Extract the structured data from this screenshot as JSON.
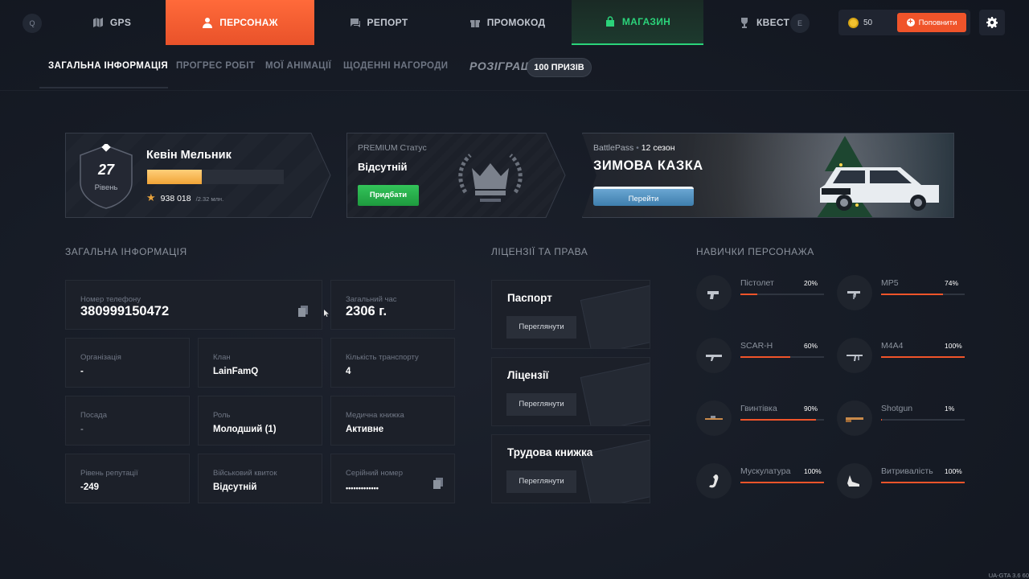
{
  "topnav": {
    "key_left": "Q",
    "key_right": "E",
    "tabs": [
      {
        "label": "GPS",
        "icon": "map-icon"
      },
      {
        "label": "ПЕРСОНАЖ",
        "icon": "user-icon"
      },
      {
        "label": "РЕПОРТ",
        "icon": "chat-icon"
      },
      {
        "label": "ПРОМОКОД",
        "icon": "gift-icon"
      },
      {
        "label": "МАГАЗИН",
        "icon": "shopping-bag-icon"
      },
      {
        "label": "КВЕСТ",
        "icon": "trophy-icon"
      }
    ],
    "active_tab": "ПЕРСОНАЖ",
    "coins": "50",
    "topup_label": "Поповнити"
  },
  "subnav": {
    "tabs": [
      "ЗАГАЛЬНА ІНФОРМАЦІЯ",
      "ПРОГРЕС РОБІТ",
      "МОЇ АНІМАЦІЇ",
      "ЩОДЕННІ НАГОРОДИ"
    ],
    "raffle_title": "РОЗІГРАШ",
    "raffle_badge": "100 ПРИЗІВ"
  },
  "player": {
    "level": "27",
    "level_label": "Рівень",
    "name": "Кевін Мельник",
    "xp": "938 018",
    "xp_max": "/2.32 млн.",
    "xp_progress": 0.4
  },
  "premium": {
    "label": "PREMIUM Статус",
    "value": "Відсутній",
    "buy_label": "Придбати"
  },
  "battlepass": {
    "label": "BattlePass",
    "season": "12 сезон",
    "title": "ЗИМОВА КАЗКА",
    "button": "Перейти"
  },
  "sections": {
    "info": "ЗАГАЛЬНА ІНФОРМАЦІЯ",
    "licenses": "ЛІЦЕНЗІЇ ТА ПРАВА",
    "skills": "НАВИЧКИ ПЕРСОНАЖА"
  },
  "info": {
    "phone_label": "Номер телефону",
    "phone": "380999150472",
    "time_label": "Загальний час",
    "time": "2306 г.",
    "org_label": "Організація",
    "org": "-",
    "clan_label": "Клан",
    "clan": "LainFamQ",
    "vehicles_label": "Кількість транспорту",
    "vehicles": "4",
    "position_label": "Посада",
    "position": "-",
    "role_label": "Роль",
    "role": "Молодший (1)",
    "medical_label": "Медична книжка",
    "medical": "Активне",
    "reputation_label": "Рівень репутації",
    "reputation": "-249",
    "military_label": "Військовий квиток",
    "military": "Відсутній",
    "serial_label": "Серійний номер",
    "serial": "•••••••••••••"
  },
  "licenses": [
    {
      "title": "Паспорт",
      "button": "Переглянути"
    },
    {
      "title": "Ліцензії",
      "button": "Переглянути"
    },
    {
      "title": "Трудова книжка",
      "button": "Переглянути"
    }
  ],
  "skills": [
    {
      "name": "Пістолет",
      "pct": "20%",
      "value": 0.2,
      "icon": "pistol-icon"
    },
    {
      "name": "MP5",
      "pct": "74%",
      "value": 0.74,
      "icon": "smg-icon"
    },
    {
      "name": "SCAR-H",
      "pct": "60%",
      "value": 0.6,
      "icon": "rifle-icon"
    },
    {
      "name": "M4A4",
      "pct": "100%",
      "value": 1.0,
      "icon": "assault-rifle-icon"
    },
    {
      "name": "Гвинтівка",
      "pct": "90%",
      "value": 0.9,
      "icon": "sniper-icon"
    },
    {
      "name": "Shotgun",
      "pct": "1%",
      "value": 0.01,
      "icon": "shotgun-icon"
    },
    {
      "name": "Мускулатура",
      "pct": "100%",
      "value": 1.0,
      "icon": "arm-muscle-icon"
    },
    {
      "name": "Витривалість",
      "pct": "100%",
      "value": 1.0,
      "icon": "sneaker-icon"
    }
  ],
  "version": "UA-GTA 3.6   60",
  "colors": {
    "accent": "#f0542a",
    "shop_green": "#2bd37a",
    "background": "#161b25"
  }
}
